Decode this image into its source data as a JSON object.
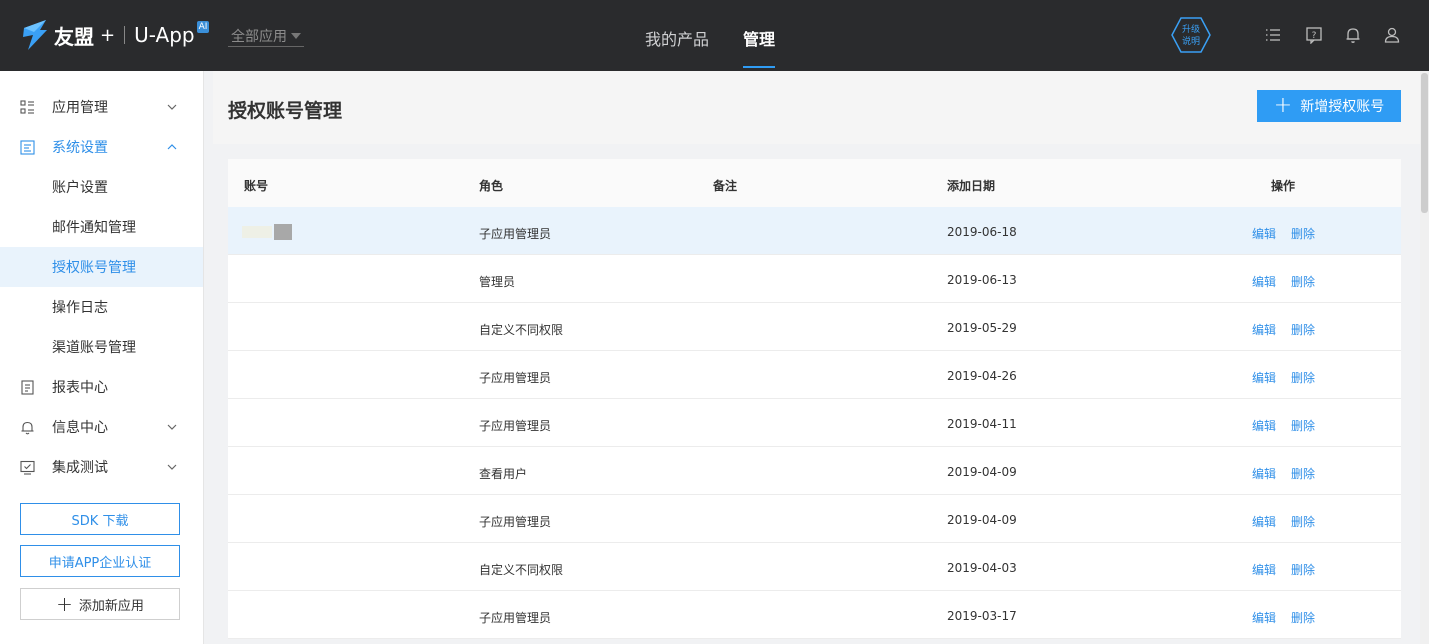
{
  "brand": {
    "name": "友盟",
    "plus": "+",
    "product": "U-App",
    "badge": "AI"
  },
  "app_select": {
    "value": "全部应用"
  },
  "nav": {
    "tabs": [
      {
        "label": "我的产品"
      },
      {
        "label": "管理"
      }
    ]
  },
  "upgrade": {
    "line1": "升级",
    "line2": "说明"
  },
  "sidebar": {
    "items": [
      {
        "label": "应用管理"
      },
      {
        "label": "系统设置"
      },
      {
        "label": "账户设置"
      },
      {
        "label": "邮件通知管理"
      },
      {
        "label": "授权账号管理"
      },
      {
        "label": "操作日志"
      },
      {
        "label": "渠道账号管理"
      },
      {
        "label": "报表中心"
      },
      {
        "label": "信息中心"
      },
      {
        "label": "集成测试"
      }
    ],
    "buttons": {
      "sdk": "SDK 下载",
      "cert": "申请APP企业认证",
      "add_app": "添加新应用"
    }
  },
  "page": {
    "title": "授权账号管理",
    "add_button": "新增授权账号"
  },
  "table": {
    "headers": {
      "account": "账号",
      "role": "角色",
      "note": "备注",
      "date": "添加日期",
      "action": "操作"
    },
    "actions": {
      "edit": "编辑",
      "delete": "删除"
    },
    "rows": [
      {
        "role": "子应用管理员",
        "date": "2019-06-18"
      },
      {
        "role": "管理员",
        "date": "2019-06-13"
      },
      {
        "role": "自定义不同权限",
        "date": "2019-05-29"
      },
      {
        "role": "子应用管理员",
        "date": "2019-04-26"
      },
      {
        "role": "子应用管理员",
        "date": "2019-04-11"
      },
      {
        "role": "查看用户",
        "date": "2019-04-09"
      },
      {
        "role": "子应用管理员",
        "date": "2019-04-09"
      },
      {
        "role": "自定义不同权限",
        "date": "2019-04-03"
      },
      {
        "role": "子应用管理员",
        "date": "2019-03-17"
      }
    ]
  },
  "colors": {
    "accent": "#2f9cf4",
    "link": "#2f8fe8",
    "topbar": "#2a2b2d",
    "selected_bg": "#e9f3fc"
  }
}
